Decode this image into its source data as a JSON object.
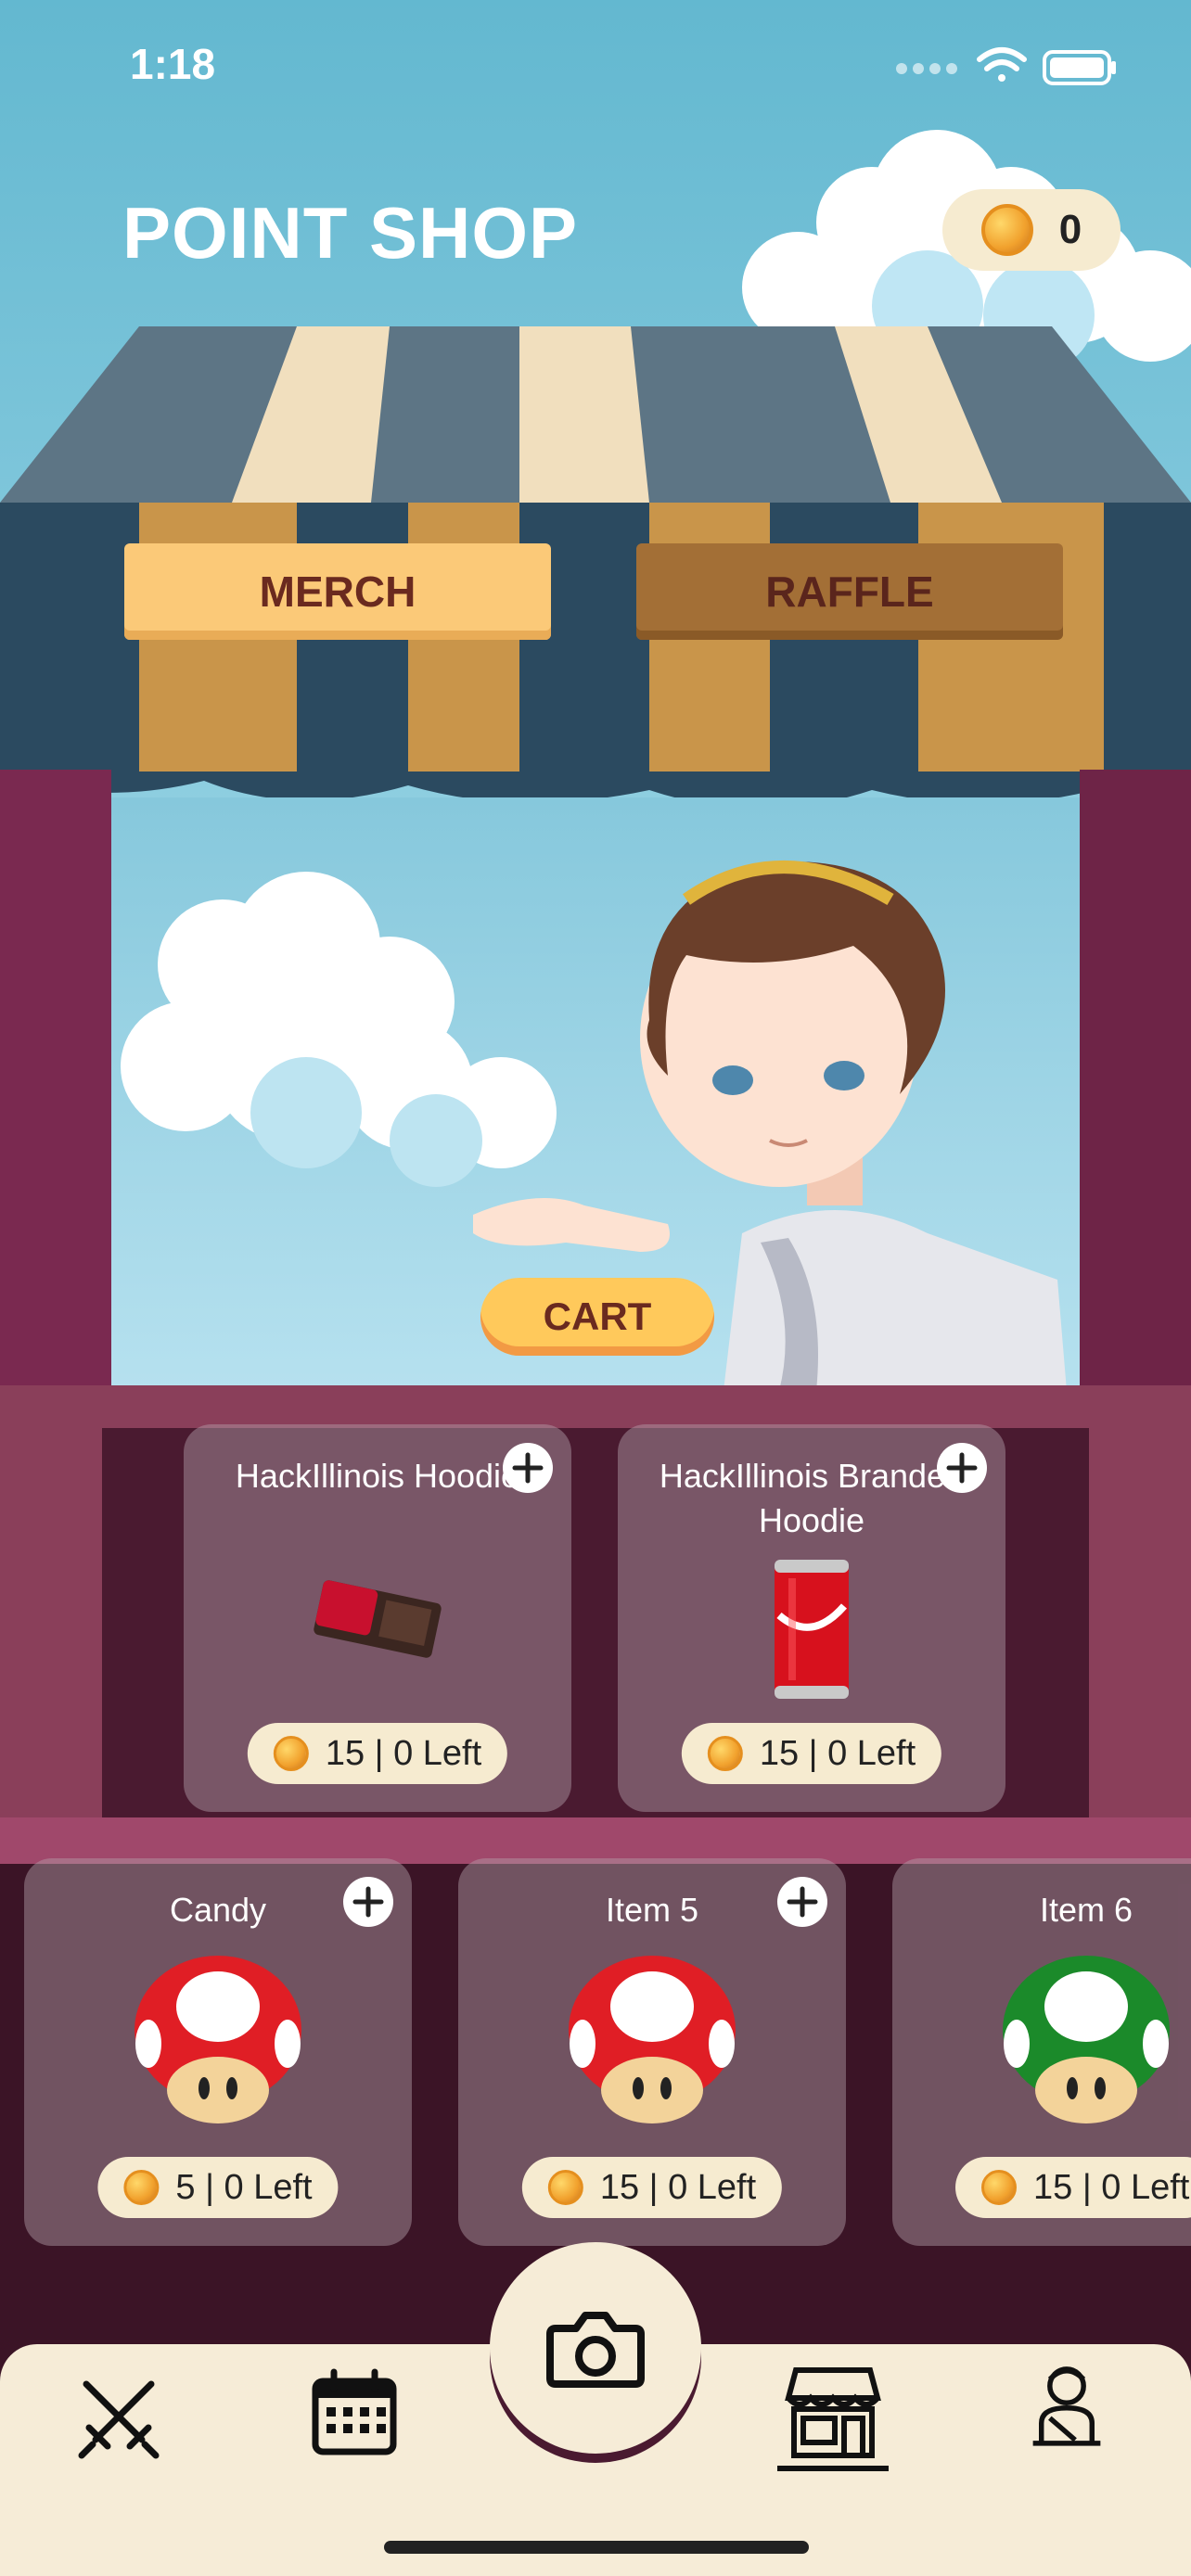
{
  "status": {
    "time": "1:18"
  },
  "header": {
    "title": "POINT SHOP",
    "points": "0"
  },
  "tabs": {
    "merch": "MERCH",
    "raffle": "RAFFLE"
  },
  "cart_label": "CART",
  "items": [
    {
      "name": "HackIllinois Hoodie",
      "price": "15 | 0 Left",
      "image": "kitkat-bar"
    },
    {
      "name": "HackIllinois Branded Hoodie",
      "price": "15 | 0 Left",
      "image": "coca-cola-can"
    },
    {
      "name": "Candy",
      "price": "5 | 0 Left",
      "image": "red-mushroom"
    },
    {
      "name": "Item 5",
      "price": "15 | 0 Left",
      "image": "red-mushroom"
    },
    {
      "name": "Item 6",
      "price": "15 | 0 Left",
      "image": "green-mushroom"
    }
  ],
  "nav": [
    "swords-icon",
    "calendar-icon",
    "camera-icon",
    "shop-icon",
    "profile-icon"
  ]
}
